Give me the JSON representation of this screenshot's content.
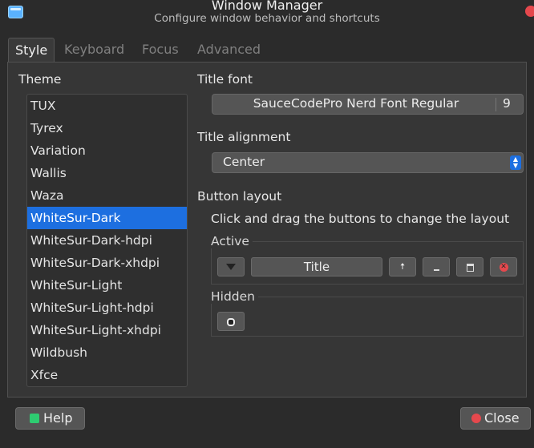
{
  "window": {
    "title": "Window Manager",
    "subtitle": "Configure window behavior and shortcuts"
  },
  "tabs": [
    {
      "label": "Style"
    },
    {
      "label": "Keyboard"
    },
    {
      "label": "Focus"
    },
    {
      "label": "Advanced"
    }
  ],
  "theme": {
    "label": "Theme",
    "items": [
      "TUX",
      "Tyrex",
      "Variation",
      "Wallis",
      "Waza",
      "WhiteSur-Dark",
      "WhiteSur-Dark-hdpi",
      "WhiteSur-Dark-xhdpi",
      "WhiteSur-Light",
      "WhiteSur-Light-hdpi",
      "WhiteSur-Light-xhdpi",
      "Wildbush",
      "Xfce"
    ],
    "selected": "WhiteSur-Dark"
  },
  "title_font": {
    "label": "Title font",
    "font": "SauceCodePro Nerd Font Regular",
    "size": "9"
  },
  "title_alignment": {
    "label": "Title alignment",
    "value": "Center"
  },
  "button_layout": {
    "label": "Button layout",
    "hint": "Click and drag the buttons to change the layout",
    "active_label": "Active",
    "hidden_label": "Hidden",
    "title_button": "Title"
  },
  "footer": {
    "help": "Help",
    "close": "Close"
  },
  "colors": {
    "accent": "#1d6fe0",
    "close": "#e5484d",
    "help": "#2ecc71"
  }
}
